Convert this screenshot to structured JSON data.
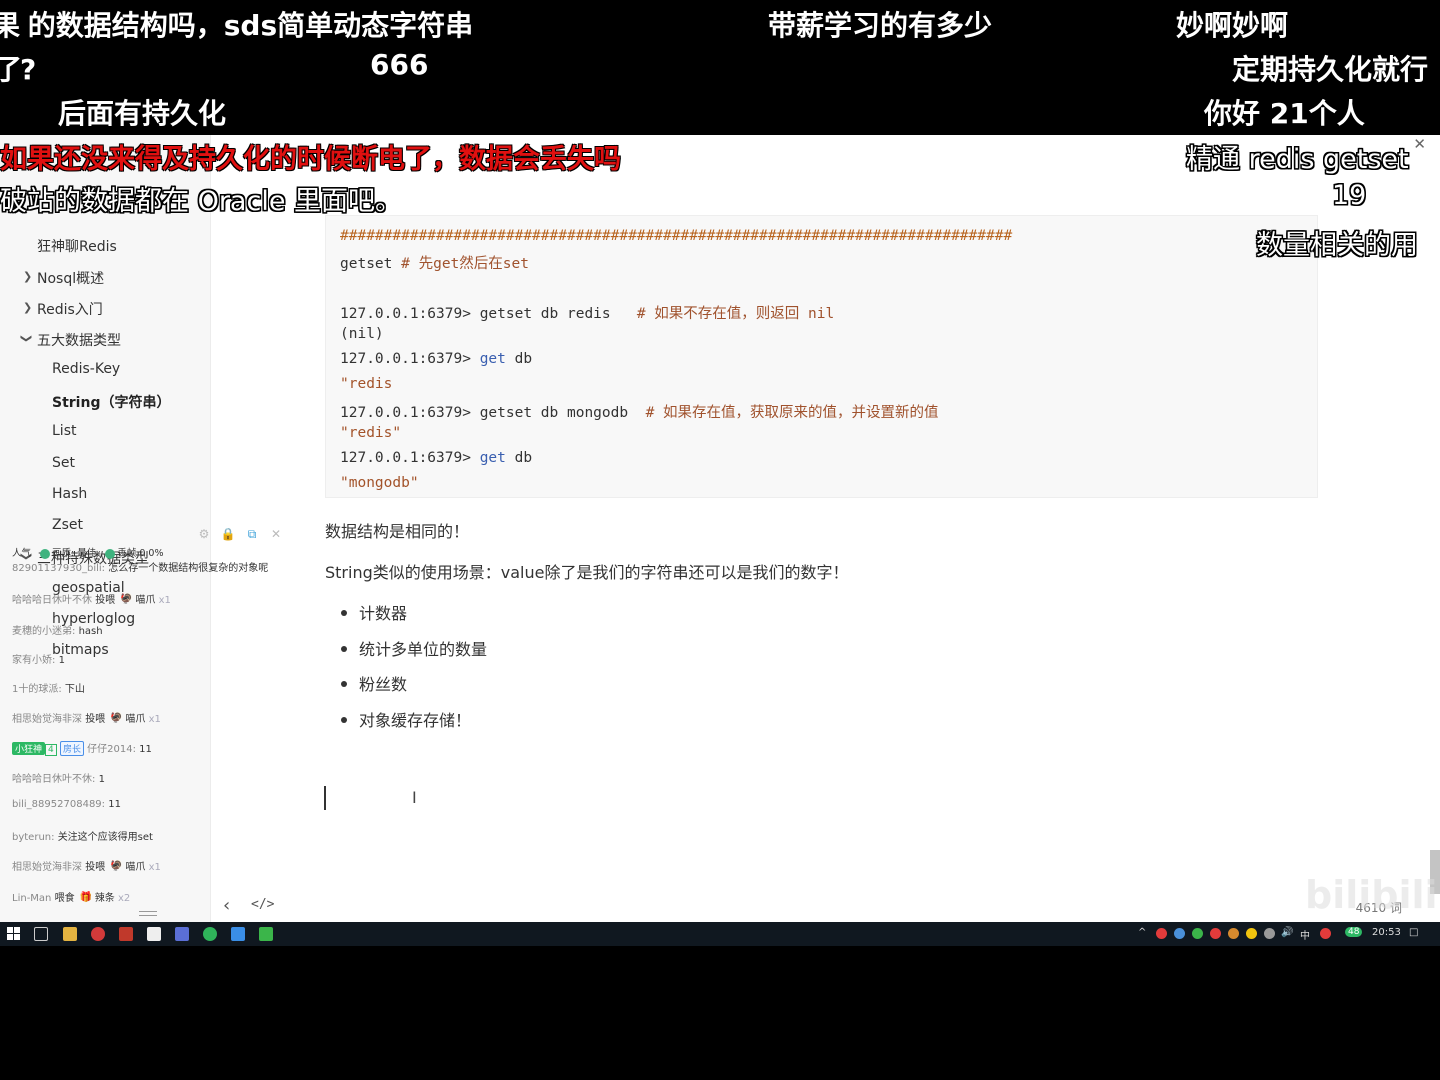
{
  "danmaku_top": [
    "的数据结构吗，sds简单动态字符串",
    "带薪学习的有多少",
    "妙啊妙啊",
    "?",
    "666",
    "定期持久化就行",
    "后面有持久化",
    "你好 21个人"
  ],
  "danmaku_overlay": [
    "如果还没来得及持久化的时候断电了，数据会丢失吗",
    "破站的数据都在 Oracle 里面吧。",
    "精通 redis getset",
    "19",
    "数量相关的用"
  ],
  "sidebar": {
    "items": [
      "狂神聊Redis",
      "Nosql概述",
      "Redis入门",
      "五大数据类型",
      "Redis-Key",
      "String（字符串）",
      "List",
      "Set",
      "Hash",
      "Zset",
      "三种特殊数据类型",
      "geospatial",
      "hyperloglog",
      "bitmaps"
    ]
  },
  "code": {
    "rule": "#############################################################################",
    "l1_cmd": "getset",
    "l1_com": "# 先get然后在set",
    "prompt": "127.0.0.1:6379>",
    "l2_cmd": "getset db redis",
    "l2_com": "# 如果不存在值，则返回 nil",
    "l3": "(nil)",
    "get_kw": "get",
    "db": "db",
    "l5": "\"redis",
    "l6_cmd": "getset db mongodb",
    "l6_com": "# 如果存在值，获取原来的值，并设置新的值",
    "l7": "\"redis\"",
    "l9": "\"mongodb\""
  },
  "content": {
    "p1": "数据结构是相同的！",
    "p2": "String类似的使用场景：value除了是我们的字符串还可以是我们的数字！",
    "bullets": [
      "计数器",
      "统计多单位的数量",
      "粉丝数",
      "对象缓存存储！"
    ]
  },
  "editor_footer": {
    "back": "‹",
    "source": "</>",
    "word_count": "4610 词"
  },
  "chat": {
    "status_prefix": "人气",
    "quality_label": "画质: 最佳",
    "drop_label": "丢帧 0.0%",
    "lines": [
      {
        "user": "82901137930_bili:",
        "msg": "怎么存一个数据结构很复杂的对象呢"
      },
      {
        "user": "哈哈哈日休叶不休",
        "msg": "投喂",
        "gift": "喵爪",
        "cnt": "x1"
      },
      {
        "user": "麦穗的小迷弟:",
        "msg": "hash"
      },
      {
        "user": "家有小娇:",
        "msg": "1"
      },
      {
        "user": "1十的球派:",
        "msg": "下山"
      },
      {
        "user": "相思始觉海非深",
        "msg": "投喂",
        "gift": "喵爪",
        "cnt": "x1"
      },
      {
        "badge": "小狂神",
        "lv": "4",
        "role": "房长",
        "user": "仔仔2014:",
        "msg": "11"
      },
      {
        "user": "哈哈哈日休叶不休:",
        "msg": "1"
      },
      {
        "user": "bili_88952708489:",
        "msg": "11"
      },
      {
        "user": "byterun:",
        "msg": "关注这个应该得用set"
      },
      {
        "user": "相思始觉海非深",
        "msg": "投喂",
        "gift": "喵爪",
        "cnt": "x1"
      },
      {
        "user": "Lin-Man",
        "msg": "喂食",
        "gift": "辣条",
        "cnt": "x2"
      }
    ]
  },
  "watermark": "bilibili",
  "taskbar": {
    "clock": "20:53",
    "ime": "中",
    "battery": "48"
  },
  "colors": {
    "danmaku_red": "#e01010",
    "code_comment": "#a0522d",
    "code_keyword": "#3a5fb0",
    "status_green": "#3fb37f"
  }
}
